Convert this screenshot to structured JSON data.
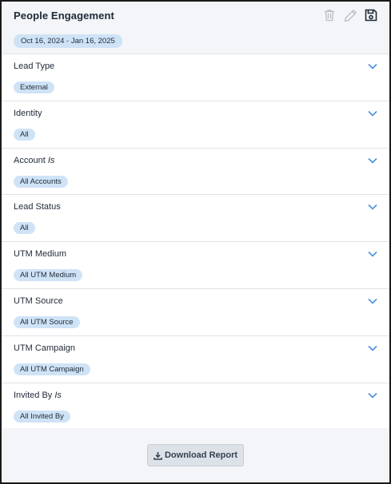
{
  "header": {
    "title": "People Engagement"
  },
  "date_range": "Oct 16, 2024 - Jan 16, 2025",
  "filters": [
    {
      "label": "Lead Type",
      "qualifier": "",
      "value": "External"
    },
    {
      "label": "Identity",
      "qualifier": "",
      "value": "All"
    },
    {
      "label": "Account",
      "qualifier": "Is",
      "value": "All Accounts"
    },
    {
      "label": "Lead Status",
      "qualifier": "",
      "value": "All"
    },
    {
      "label": "UTM Medium",
      "qualifier": "",
      "value": "All UTM Medium"
    },
    {
      "label": "UTM Source",
      "qualifier": "",
      "value": "All UTM Source"
    },
    {
      "label": "UTM Campaign",
      "qualifier": "",
      "value": "All UTM Campaign"
    },
    {
      "label": "Invited By",
      "qualifier": "Is",
      "value": "All Invited By"
    }
  ],
  "footer": {
    "download_label": "Download Report"
  },
  "icons": [
    "trash-icon",
    "pencil-icon",
    "save-icon",
    "chevron-down-icon",
    "download-icon"
  ],
  "colors": {
    "chip_bg": "#cfe3f6",
    "panel_bg": "#f3f5f8",
    "chevron": "#4a90d9",
    "icon_muted": "#b8bcc2"
  }
}
